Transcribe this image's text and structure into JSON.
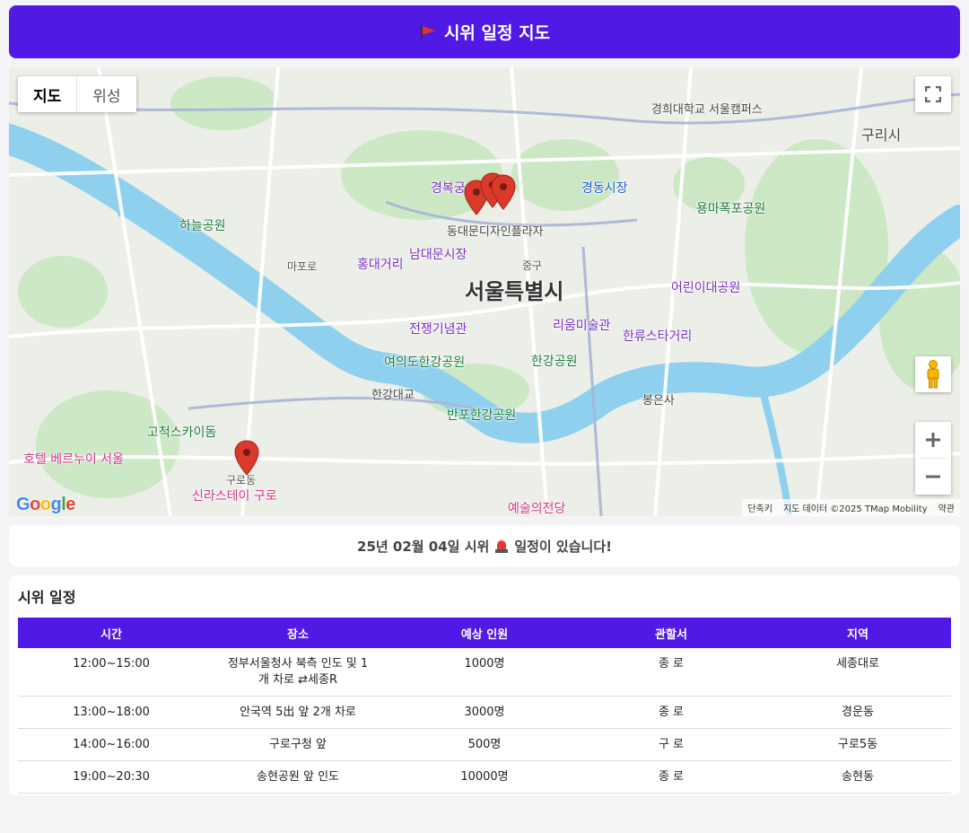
{
  "header": {
    "title": "시위 일정 지도",
    "icon": "flag-icon"
  },
  "map": {
    "type_buttons": {
      "map": "지도",
      "satellite": "위성"
    },
    "labels": {
      "city": "서울특별시",
      "guri": "구리시",
      "gyeongbokgung": "경복궁",
      "gyeongdong_market": "경동시장",
      "dongdaemun": "동대문디자인플라자",
      "namdaemun": "남대문시장",
      "hongdae": "홍대거리",
      "haneul_park": "하늘공원",
      "memorial": "전쟁기념관",
      "leeum": "리움미술관",
      "hanryu": "한류스타거리",
      "children_park": "어린이대공원",
      "yeouido_park": "여의도한강공원",
      "hangang_bridge": "한강대교",
      "banpo_park": "반포한강공원",
      "hangang_park": "한강공원",
      "bongeunsa": "봉은사",
      "gocheok": "고척스카이돔",
      "hotel_bernui": "호텔 베르누이 서울",
      "shilla": "신라스테이 구로",
      "kyunghee": "경희대학교 서울캠퍼스",
      "yongma": "용마폭포공원",
      "arts_center": "예술의전당",
      "guro_dong": "구로동",
      "mapo": "마포로",
      "junggu": "중구"
    },
    "attribution": {
      "shortcuts": "단축키",
      "data": "지도 데이터 ©2025 TMap Mobility",
      "terms": "약관"
    },
    "logo": "Google"
  },
  "notice": {
    "prefix": "25년 02월 04일 시위",
    "suffix": "일정이 있습니다!"
  },
  "schedule": {
    "title": "시위 일정",
    "columns": [
      "시간",
      "장소",
      "예상 인원",
      "관할서",
      "지역"
    ],
    "rows": [
      [
        "12:00~15:00",
        "정부서울청사 북측 인도 및 1개 차로 ⇄세종R",
        "1000명",
        "종 로",
        "세종대로"
      ],
      [
        "13:00~18:00",
        "안국역 5出 앞 2개 차로",
        "3000명",
        "종 로",
        "경운동"
      ],
      [
        "14:00~16:00",
        "구로구청 앞",
        "500명",
        "구 로",
        "구로5동"
      ],
      [
        "19:00~20:30",
        "송현공원 앞 인도",
        "10000명",
        "종 로",
        "송현동"
      ]
    ]
  },
  "colors": {
    "accent": "#5119e6",
    "marker": "#d93a2b",
    "water": "#8fd0ee"
  }
}
